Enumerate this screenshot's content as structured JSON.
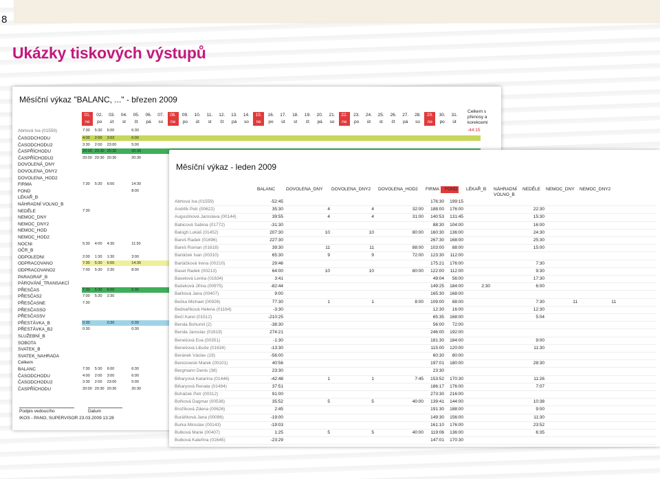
{
  "page": {
    "number": "8",
    "title": "Ukázky tiskových výstupů"
  },
  "sheet1": {
    "title": "Měsíční výkaz \"BALANC, ...\" - březen 2009",
    "days": [
      {
        "n": "01.",
        "w": "ne",
        "red": true
      },
      {
        "n": "02.",
        "w": "po"
      },
      {
        "n": "03.",
        "w": "út"
      },
      {
        "n": "04.",
        "w": "st"
      },
      {
        "n": "05.",
        "w": "čt"
      },
      {
        "n": "06.",
        "w": "pá"
      },
      {
        "n": "07.",
        "w": "so"
      },
      {
        "n": "08.",
        "w": "ne",
        "red": true
      },
      {
        "n": "09.",
        "w": "po"
      },
      {
        "n": "10.",
        "w": "út"
      },
      {
        "n": "11.",
        "w": "st"
      },
      {
        "n": "12.",
        "w": "čt"
      },
      {
        "n": "13.",
        "w": "pá"
      },
      {
        "n": "14.",
        "w": "so"
      },
      {
        "n": "15.",
        "w": "ne",
        "red": true
      },
      {
        "n": "16.",
        "w": "po"
      },
      {
        "n": "17.",
        "w": "út"
      },
      {
        "n": "18.",
        "w": "st"
      },
      {
        "n": "19.",
        "w": "čt"
      },
      {
        "n": "20.",
        "w": "pá"
      },
      {
        "n": "21.",
        "w": "so"
      },
      {
        "n": "22.",
        "w": "ne",
        "red": true
      },
      {
        "n": "23.",
        "w": "po"
      },
      {
        "n": "24.",
        "w": "út"
      },
      {
        "n": "25.",
        "w": "st"
      },
      {
        "n": "26.",
        "w": "čt"
      },
      {
        "n": "27.",
        "w": "pá"
      },
      {
        "n": "28.",
        "w": "so"
      },
      {
        "n": "29.",
        "w": "ne",
        "red": true
      },
      {
        "n": "30.",
        "w": "po"
      },
      {
        "n": "31.",
        "w": "út"
      }
    ],
    "celkem_header": "Celkem s přenosy a korekcemi",
    "employee": "Abrtová Iva (01559)",
    "employee_values": [
      "7:30",
      "5:30",
      "6:00",
      "",
      "6:30"
    ],
    "employee_total": "-44:15",
    "rows": [
      {
        "label": "ČASODCHODU",
        "values": [
          "4:00",
          "2:00",
          "3:03",
          "",
          "6:00"
        ],
        "bar": "#c8d65a"
      },
      {
        "label": "ČASODCHODU2",
        "values": [
          "3:30",
          "2:00",
          "23:00",
          "",
          "5:00"
        ]
      },
      {
        "label": "ČASPŘÍCHODU",
        "values": [
          "20:00",
          "20:30",
          "20:30",
          "",
          "20:30"
        ],
        "bar": "#3fae5a"
      },
      {
        "label": "ČASPŘÍCHODU2",
        "values": [
          "20:00",
          "20:30",
          "20:30",
          "",
          "20:30"
        ]
      },
      {
        "label": "DOVOLENÁ_DNY",
        "values": []
      },
      {
        "label": "DOVOLENA_DNY2",
        "values": []
      },
      {
        "label": "DOVOLENA_HOD2",
        "values": []
      },
      {
        "label": "FIRMA",
        "values": [
          "7:30",
          "5:30",
          "6:00",
          "",
          "14:30"
        ]
      },
      {
        "label": "FOND",
        "values": [
          "",
          "",
          "",
          "",
          "8:00"
        ]
      },
      {
        "label": "LÉKAŘ_B",
        "values": []
      },
      {
        "label": "NÁHRADNÍ VOLNO_B",
        "values": []
      },
      {
        "label": "NEDĚLE",
        "values": [
          "7:30"
        ]
      },
      {
        "label": "NEMOC_DNY",
        "values": []
      },
      {
        "label": "NEMOC_DNY2",
        "values": []
      },
      {
        "label": "NEMOC_HOD",
        "values": []
      },
      {
        "label": "NEMOC_HOD2",
        "values": []
      },
      {
        "label": "NOCNI",
        "values": [
          "5:30",
          "4:00",
          "4:30",
          "",
          "11:30"
        ]
      },
      {
        "label": "OČR_B",
        "values": []
      },
      {
        "label": "ODPOLEDNI",
        "values": [
          "2:00",
          "1:30",
          "1:30",
          "",
          "3:00"
        ]
      },
      {
        "label": "ODPRACOVANO",
        "values": [
          "7:30",
          "5:30",
          "6:00",
          "",
          "14:30"
        ],
        "bar": "#f0ef9a"
      },
      {
        "label": "ODPRACOVANO2",
        "values": [
          "7:00",
          "5:30",
          "2:30",
          "",
          "8:00"
        ]
      },
      {
        "label": "PARAGRAF_B",
        "values": []
      },
      {
        "label": "PÁROVÁNÍ_TRANSAKCÍ",
        "values": []
      },
      {
        "label": "PŘESČAS",
        "values": [
          "7:30",
          "5:30",
          "6:00",
          "",
          "6:30"
        ],
        "bar": "#3fae5a"
      },
      {
        "label": "PŘESČAS2",
        "values": [
          "7:00",
          "5:30",
          "2:30"
        ]
      },
      {
        "label": "PŘESČASNE",
        "values": [
          "7:30"
        ]
      },
      {
        "label": "PŘESČASSO",
        "values": []
      },
      {
        "label": "PŘESČASSV",
        "values": []
      },
      {
        "label": "PŘESTÁVKA_B",
        "values": [
          "0:30",
          "",
          "0:30",
          "",
          "0:30"
        ],
        "bar": "#9fd3e6"
      },
      {
        "label": "PŘESTÁVKA_B2",
        "values": [
          "0:30",
          "",
          "",
          "",
          "0:30"
        ]
      },
      {
        "label": "SLUŽEBNÍ_B",
        "values": []
      },
      {
        "label": "SOBOTA",
        "values": []
      },
      {
        "label": "SVATEK_B",
        "values": []
      },
      {
        "label": "SVATEK_NAHRADA",
        "values": []
      },
      {
        "label": "Celkem",
        "values": []
      },
      {
        "label": "BALANC",
        "values": [
          "7:30",
          "5:30",
          "6:00",
          "",
          "6:30"
        ]
      },
      {
        "label": "ČASODCHODU",
        "values": [
          "4:00",
          "2:00",
          "3:00",
          "",
          "6:00"
        ]
      },
      {
        "label": "ČASODCHODU2",
        "values": [
          "3:30",
          "2:00",
          "23:00",
          "",
          "5:00"
        ]
      },
      {
        "label": "ČASPŘÍCHODU",
        "values": [
          "20:00",
          "20:30",
          "20:30",
          "",
          "20:30"
        ]
      }
    ],
    "footer": {
      "sign1": "Podpis vedoucího",
      "sign2": "Datum",
      "printed": "IKOS - PANO, SUPERVISOR 23.03.2009 13:28"
    }
  },
  "sheet2": {
    "title": "Měsíční výkaz - leden 2009",
    "columns": [
      "BALANC",
      "DOVOLENA_DNY",
      "DOVOLENA_DNY2",
      "DOVOLENA_HOD2",
      "FIRMA",
      "FOND",
      "LÉKAŘ_B",
      "NÁHRADNÍ VOLNO_B",
      "NEDĚLE",
      "NEMOC_DNY",
      "NEMOC_DNY2"
    ],
    "rows": [
      {
        "name": "Abrtová Iva (01559)",
        "c": [
          "-52:45",
          "",
          "",
          "",
          "176:30",
          "199:15",
          "",
          "",
          "",
          "",
          ""
        ]
      },
      {
        "name": "Andrlík Petr (00622)",
        "c": [
          "35:30",
          "4",
          "4",
          "32:00",
          "188:00",
          "176:00",
          "",
          "",
          "22:30",
          "",
          ""
        ]
      },
      {
        "name": "Augustinová Jaroslava (00144)",
        "c": [
          "39:55",
          "4",
          "4",
          "31:00",
          "140:53",
          "131:45",
          "",
          "",
          "15:30",
          "",
          ""
        ]
      },
      {
        "name": "Babicová Sabina (01772)",
        "c": [
          "-31:30",
          "",
          "",
          "",
          "88:30",
          "104:00",
          "",
          "",
          "16:00",
          "",
          ""
        ]
      },
      {
        "name": "Balogh Lukáš (01452)",
        "c": [
          "207:30",
          "10",
          "10",
          "80:00",
          "160:30",
          "136:00",
          "",
          "",
          "24:30",
          "",
          ""
        ]
      },
      {
        "name": "Bareš Radek (01696)",
        "c": [
          "227:30",
          "",
          "",
          "",
          "267:30",
          "168:00",
          "",
          "",
          "25:30",
          "",
          ""
        ]
      },
      {
        "name": "Bareš Roman (01618)",
        "c": [
          "39:30",
          "11",
          "11",
          "88:00",
          "103:00",
          "88:00",
          "",
          "",
          "15:00",
          "",
          ""
        ]
      },
      {
        "name": "Bartáček Ivan (00310)",
        "c": [
          "65:30",
          "9",
          "9",
          "72:00",
          "123:30",
          "112:00",
          "",
          "",
          "",
          "",
          ""
        ]
      },
      {
        "name": "Bartáčková Irena (00210)",
        "c": [
          "29:46",
          "",
          "",
          "",
          "175:21",
          "176:00",
          "",
          "",
          "7:30",
          "",
          ""
        ]
      },
      {
        "name": "Basel Radek (00213)",
        "c": [
          "64:00",
          "10",
          "10",
          "80:00",
          "122:00",
          "112:00",
          "",
          "",
          "9:30",
          "",
          ""
        ]
      },
      {
        "name": "Baselová Lenka (01634)",
        "c": [
          "3:41",
          "",
          "",
          "",
          "49:04",
          "56:00",
          "",
          "",
          "17:30",
          "",
          ""
        ]
      },
      {
        "name": "Bašeková Jiřina (00975)",
        "c": [
          "-82:44",
          "",
          "",
          "",
          "149:25",
          "184:00",
          "2:30",
          "",
          "6:00",
          "",
          ""
        ]
      },
      {
        "name": "Baťková Jana (00407)",
        "c": [
          "9:00",
          "",
          "",
          "",
          "165:30",
          "168:00",
          "",
          "",
          "",
          "",
          ""
        ]
      },
      {
        "name": "Bečka Michael (00926)",
        "c": [
          "77:30",
          "1",
          "1",
          "8:00",
          "109:00",
          "88:00",
          "",
          "",
          "7:30",
          "11",
          "11"
        ]
      },
      {
        "name": "Bednaříková Helena (01164)",
        "c": [
          "-3:30",
          "",
          "",
          "",
          "12:30",
          "16:00",
          "",
          "",
          "12:30",
          "",
          ""
        ]
      },
      {
        "name": "Bečí Karel (01512)",
        "c": [
          "-210:25",
          "",
          "",
          "",
          "65:35",
          "168:00",
          "",
          "",
          "5:04",
          "",
          ""
        ]
      },
      {
        "name": "Benda Bohumil (2)",
        "c": [
          "-38:30",
          "",
          "",
          "",
          "56:00",
          "72:00",
          "",
          "",
          "",
          "",
          ""
        ]
      },
      {
        "name": "Benda Jaroslav (01619)",
        "c": [
          "274:21",
          "",
          "",
          "",
          "246:00",
          "192:00",
          "",
          "",
          "",
          "",
          ""
        ]
      },
      {
        "name": "Benešová Eva (00351)",
        "c": [
          "-1:30",
          "",
          "",
          "",
          "181:30",
          "184:00",
          "",
          "",
          "9:00",
          "",
          ""
        ]
      },
      {
        "name": "Benešová Libuše (01634)",
        "c": [
          "-13:30",
          "",
          "",
          "",
          "115:00",
          "120:00",
          "",
          "",
          "11:30",
          "",
          ""
        ]
      },
      {
        "name": "Beránek Václav (19)",
        "c": [
          "-56:00",
          "",
          "",
          "",
          "60:30",
          "80:00",
          "",
          "",
          "",
          "",
          ""
        ]
      },
      {
        "name": "Berezowski Marek (00101)",
        "c": [
          "40:56",
          "",
          "",
          "",
          "197:01",
          "180:00",
          "",
          "",
          "28:30",
          "",
          ""
        ]
      },
      {
        "name": "Bergmann Denis (38)",
        "c": [
          "23:30",
          "",
          "",
          "",
          "23:30",
          "",
          "",
          "",
          "",
          "",
          ""
        ]
      },
      {
        "name": "Biharyová Katarína (01446)",
        "c": [
          "-42:48",
          "1",
          "1",
          "7:45",
          "153:52",
          "170:30",
          "",
          "",
          "11:26",
          "",
          ""
        ]
      },
      {
        "name": "Biharyová Renata (01494)",
        "c": [
          "37:51",
          "",
          "",
          "",
          "186:17",
          "176:00",
          "",
          "",
          "7:07",
          "",
          ""
        ]
      },
      {
        "name": "Boháček Petr (00312)",
        "c": [
          "91:00",
          "",
          "",
          "",
          "273:30",
          "216:00",
          "",
          "",
          "",
          "",
          ""
        ]
      },
      {
        "name": "Bořková Dagmar (00536)",
        "c": [
          "35:52",
          "5",
          "5",
          "40:00",
          "139:41",
          "144:00",
          "",
          "",
          "10:38",
          "",
          ""
        ]
      },
      {
        "name": "Brožíková Zdena (00626)",
        "c": [
          "2:45",
          "",
          "",
          "",
          "191:30",
          "188:00",
          "",
          "",
          "9:00",
          "",
          ""
        ]
      },
      {
        "name": "Buráňková Jana (00096)",
        "c": [
          "-19:00",
          "",
          "",
          "",
          "149:30",
          "156:00",
          "",
          "",
          "11:30",
          "",
          ""
        ]
      },
      {
        "name": "Burka Miroslav (00143)",
        "c": [
          "-19:03",
          "",
          "",
          "",
          "161:10",
          "176:00",
          "",
          "",
          "23:52",
          "",
          ""
        ]
      },
      {
        "name": "Butková Marie (00407)",
        "c": [
          "1:25",
          "5",
          "5",
          "40:00",
          "119:06",
          "136:00",
          "",
          "",
          "6:35",
          "",
          ""
        ]
      },
      {
        "name": "Butková Kateřina (01645)",
        "c": [
          "-23:29",
          "",
          "",
          "",
          "147:01",
          "170:30",
          "",
          "",
          "",
          "",
          ""
        ]
      }
    ]
  }
}
